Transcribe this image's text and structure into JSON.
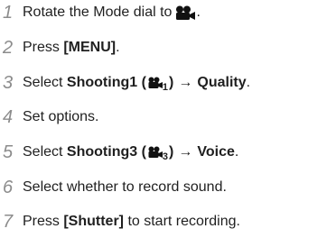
{
  "steps": [
    {
      "num": "1",
      "pre": "Rotate the Mode dial to",
      "post": "."
    },
    {
      "num": "2",
      "pre": "Press ",
      "bold": "[MENU]",
      "post": "."
    },
    {
      "num": "3",
      "pre": "Select ",
      "bold": "Shooting1",
      "paren_open": " (",
      "sub": "1",
      "paren_close": ")",
      "arrow": "→",
      "bold2": "Quality",
      "post": "."
    },
    {
      "num": "4",
      "pre": "Set options."
    },
    {
      "num": "5",
      "pre": "Select ",
      "bold": "Shooting3",
      "paren_open": " (",
      "sub": "3",
      "paren_close": ")",
      "arrow": "→",
      "bold2": "Voice",
      "post": "."
    },
    {
      "num": "6",
      "pre": "Select whether to record sound."
    },
    {
      "num": "7",
      "pre": "Press ",
      "bold": "[Shutter]",
      "post": " to start recording."
    }
  ],
  "icons": {
    "mode_icon": "movie-camera-icon",
    "menu_icon": "movie-camera-menu-icon"
  }
}
